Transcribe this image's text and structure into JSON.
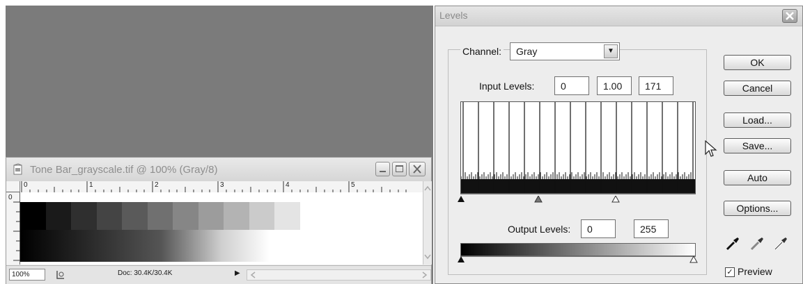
{
  "document_window": {
    "title": "Tone Bar_grayscale.tif @ 100% (Gray/8)",
    "ruler_labels": [
      "0",
      "1",
      "2",
      "3",
      "4",
      "5"
    ],
    "vertical_ruler_label": "0",
    "status_zoom": "100%",
    "status_doc": "Doc: 30.4K/30.4K",
    "step_colors": [
      "#000000",
      "#1a1a1a",
      "#2f2f2f",
      "#444444",
      "#5a5a5a",
      "#707070",
      "#868686",
      "#9c9c9c",
      "#b3b3b3",
      "#cbcbcb",
      "#e4e4e4"
    ]
  },
  "levels": {
    "title": "Levels",
    "channel_label": "Channel:",
    "channel_value": "Gray",
    "input_levels_label": "Input Levels:",
    "input_black": "0",
    "input_gamma": "1.00",
    "input_white": "171",
    "output_levels_label": "Output Levels:",
    "output_black": "0",
    "output_white": "255",
    "buttons": {
      "ok": "OK",
      "cancel": "Cancel",
      "load": "Load...",
      "save": "Save...",
      "auto": "Auto",
      "options": "Options..."
    },
    "preview_label": "Preview",
    "preview_checked": true,
    "input_handle_values": [
      0,
      1.0,
      171
    ]
  }
}
